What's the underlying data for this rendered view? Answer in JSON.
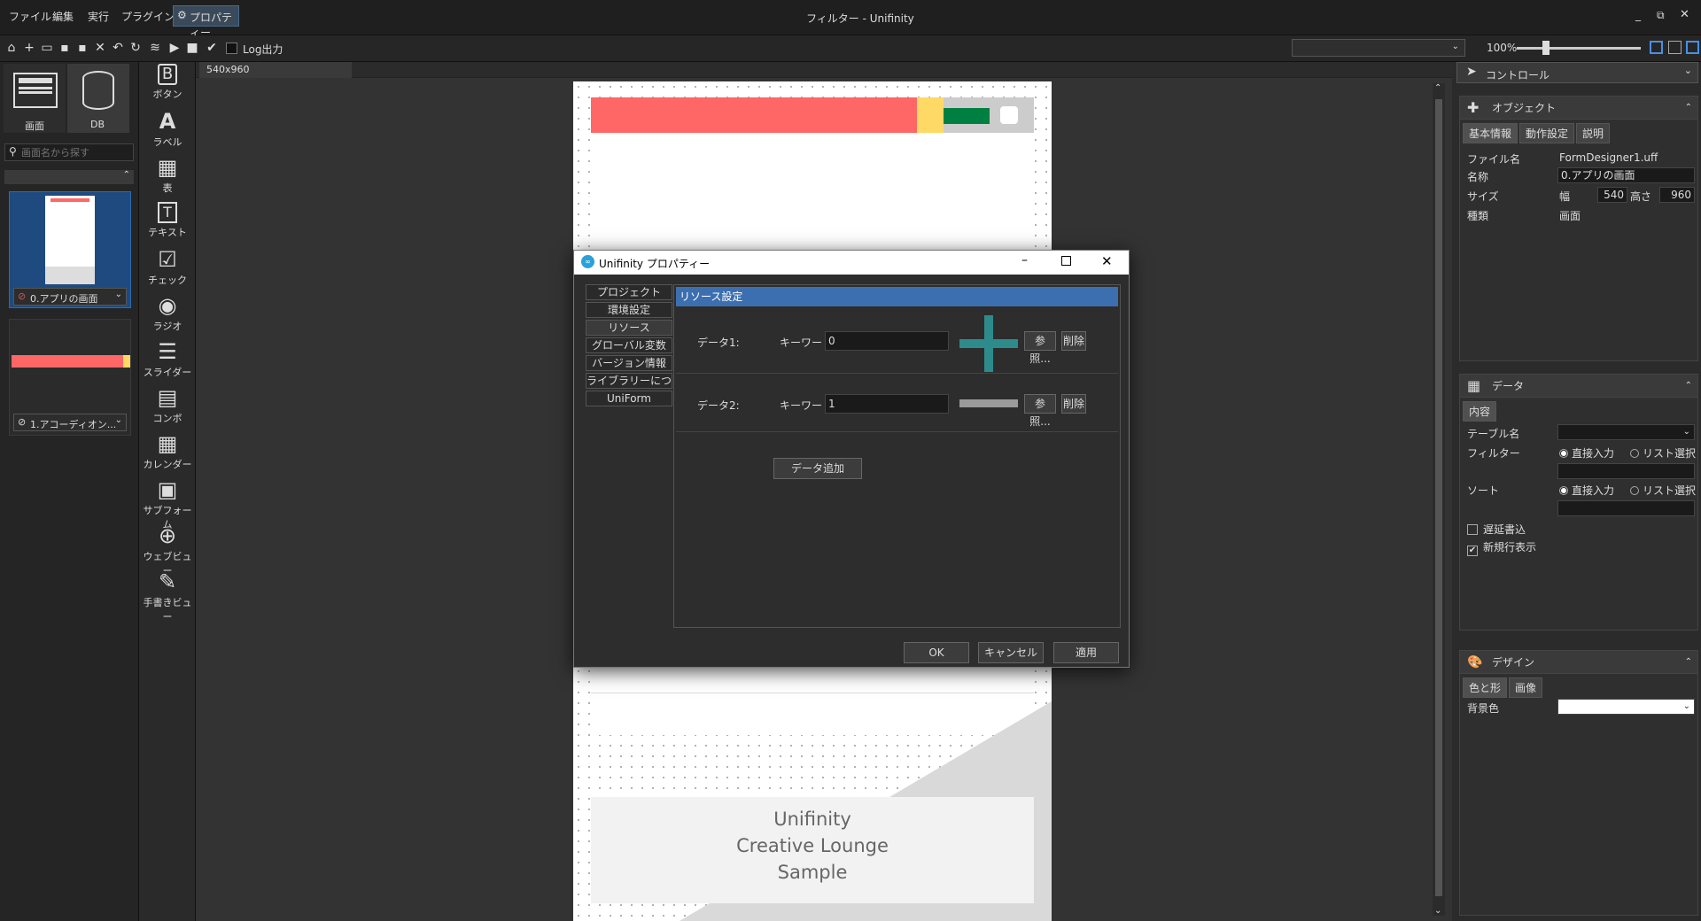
{
  "menu": {
    "file": "ファイル",
    "edit": "編集",
    "run": "実行",
    "plugin": "プラグイン",
    "properties": "プロパティー"
  },
  "window": {
    "title": "フィルター - Unifinity"
  },
  "toolbar": {
    "log_label": "Log出力",
    "zoom": "100%"
  },
  "left": {
    "screen_label": "画面",
    "db_label": "DB",
    "search_placeholder": "画面名から探す",
    "screen_items": [
      {
        "label": "0.アプリの画面"
      },
      {
        "label": "1.アコーディオン..."
      }
    ]
  },
  "palette": {
    "items": [
      {
        "label": "ボタン",
        "icon": "button-icon"
      },
      {
        "label": "ラベル",
        "icon": "label-icon"
      },
      {
        "label": "表",
        "icon": "table-icon"
      },
      {
        "label": "テキスト",
        "icon": "text-icon"
      },
      {
        "label": "チェック",
        "icon": "check-icon"
      },
      {
        "label": "ラジオ",
        "icon": "radio-icon"
      },
      {
        "label": "スライダー",
        "icon": "slider-icon"
      },
      {
        "label": "コンボ",
        "icon": "combo-icon"
      },
      {
        "label": "カレンダー",
        "icon": "calendar-icon"
      },
      {
        "label": "サブフォーム",
        "icon": "subform-icon"
      },
      {
        "label": "ウェブビュー",
        "icon": "webview-icon"
      },
      {
        "label": "手書きビュー",
        "icon": "handwriting-icon"
      }
    ]
  },
  "canvas": {
    "tab_label": "540x960",
    "sample_line1": "Unifinity",
    "sample_line2": "Creative Lounge",
    "sample_line3": "Sample",
    "colors": {
      "red": "#ff6666",
      "yellow": "#ffd966",
      "green": "#008040"
    }
  },
  "dialog": {
    "title": "Unifinity プロパティー",
    "nav": [
      "プロジェクト",
      "環境設定",
      "リソース",
      "グローバル変数",
      "バージョン情報",
      "ライブラリーについて",
      "UniForm"
    ],
    "section_title": "リソース設定",
    "rows": [
      {
        "label": "データ1:",
        "keyword_label": "キーワード:",
        "keyword_value": "0",
        "browse": "参照...",
        "delete": "削除"
      },
      {
        "label": "データ2:",
        "keyword_label": "キーワード:",
        "keyword_value": "1",
        "browse": "参照...",
        "delete": "削除"
      }
    ],
    "add_button": "データ追加",
    "ok": "OK",
    "cancel": "キャンセル",
    "apply": "適用"
  },
  "right": {
    "control_select": "コントロール",
    "object_title": "オブジェクト",
    "object_tabs": [
      "基本情報",
      "動作設定",
      "説明"
    ],
    "file_name_label": "ファイル名",
    "file_name": "FormDesigner1.uff",
    "name_label": "名称",
    "name_value": "0.アプリの画面",
    "size_label": "サイズ",
    "width_label": "幅",
    "width_value": "540",
    "height_label": "高さ",
    "height_value": "960",
    "kind_label": "種類",
    "kind_value": "画面",
    "data_title": "データ",
    "data_tab": "内容",
    "table_name_label": "テーブル名",
    "filter_label": "フィルター",
    "sort_label": "ソート",
    "direct_input": "直接入力",
    "list_select": "リスト選択",
    "delay_write": "遅延書込",
    "new_row": "新規行表示",
    "design_title": "デザイン",
    "design_tabs": [
      "色と形",
      "画像"
    ],
    "bg_label": "背景色"
  }
}
